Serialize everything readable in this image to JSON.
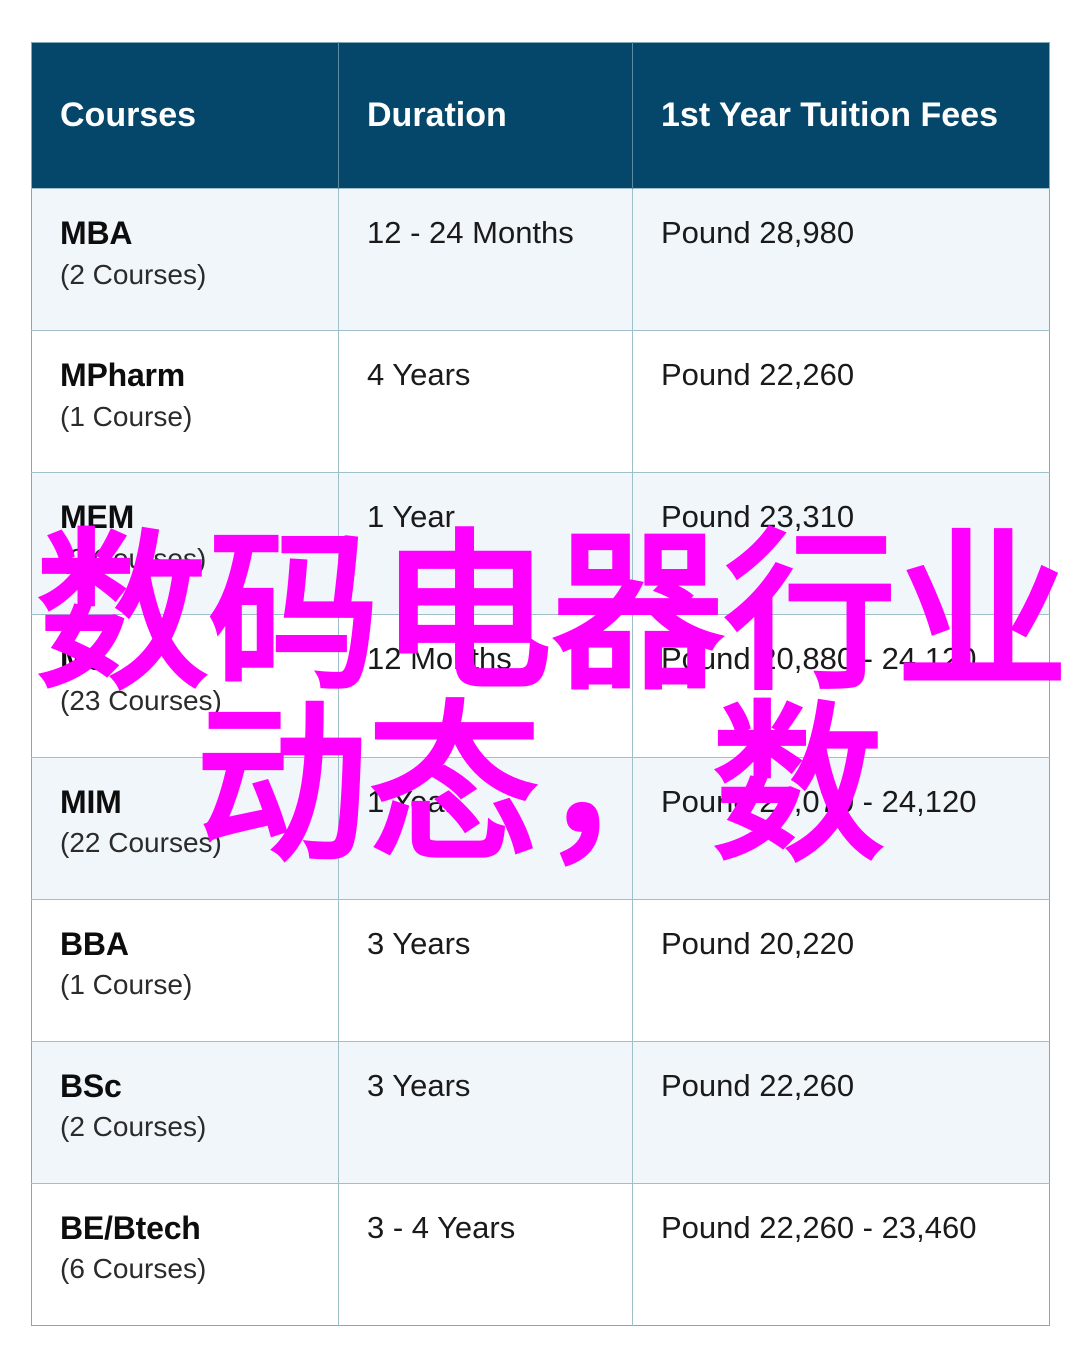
{
  "table": {
    "columns": [
      {
        "key": "course",
        "label": "Courses"
      },
      {
        "key": "duration",
        "label": "Duration"
      },
      {
        "key": "fees",
        "label": "1st Year Tuition Fees"
      }
    ],
    "rows": [
      {
        "course": "MBA",
        "count": "(2 Courses)",
        "duration": "12 - 24 Months",
        "fees": "Pound 28,980"
      },
      {
        "course": "MPharm",
        "count": "(1 Course)",
        "duration": "4 Years",
        "fees": "Pound 22,260"
      },
      {
        "course": "MEM",
        "count": "(2 Courses)",
        "duration": "1 Year",
        "fees": "Pound 23,310"
      },
      {
        "course": "MS",
        "count": "(23 Courses)",
        "duration": "12 Months",
        "fees": "Pound 20,880 - 24,120"
      },
      {
        "course": "MIM",
        "count": "(22 Courses)",
        "duration": "1 Year",
        "fees": "Pound 20,070 - 24,120"
      },
      {
        "course": "BBA",
        "count": "(1 Course)",
        "duration": "3 Years",
        "fees": "Pound 20,220"
      },
      {
        "course": "BSc",
        "count": "(2 Courses)",
        "duration": "3 Years",
        "fees": "Pound 22,260"
      },
      {
        "course": "BE/Btech",
        "count": "(6 Courses)",
        "duration": "3 - 4 Years",
        "fees": "Pound 22,260 - 23,460"
      }
    ]
  },
  "overlay": {
    "line1": "数码电器行业",
    "line2": "动态，数",
    "color": "#ff00ff"
  },
  "colors": {
    "header_background": "#04476b",
    "header_text": "#ffffff",
    "row_alt_background": "#f1f6fb",
    "row_background": "#ffffff",
    "border": "#9fc0ca",
    "table_border": "#83a9b6",
    "body_text": "#1a1a1a"
  }
}
